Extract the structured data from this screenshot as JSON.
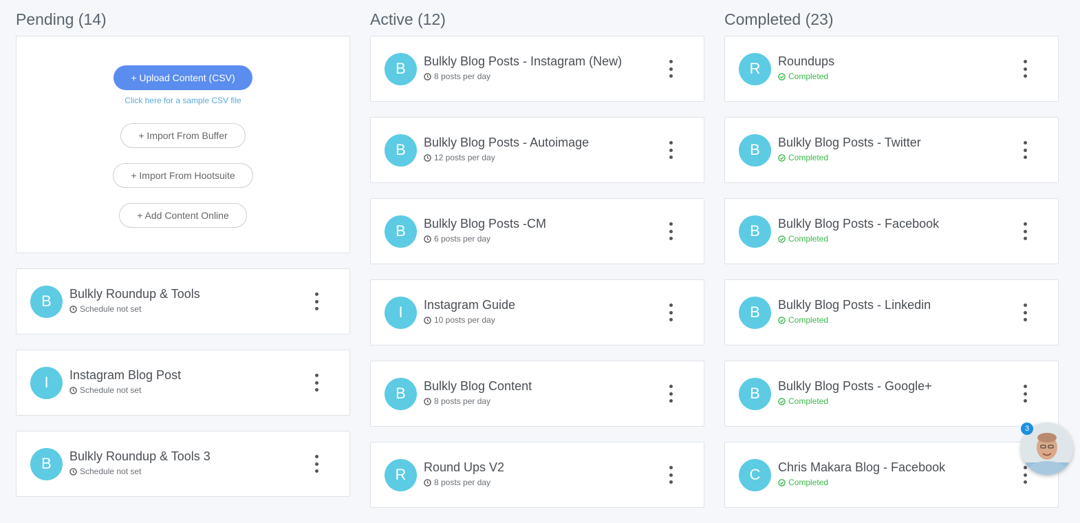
{
  "columns": {
    "pending": {
      "title": "Pending (14)",
      "upload": {
        "upload_button": "+ Upload Content (CSV)",
        "sample_link": "Click here for a sample CSV file",
        "buffer_button": "+ Import From Buffer",
        "hootsuite_button": "+ Import From Hootsuite",
        "online_button": "+ Add Content Online"
      },
      "items": [
        {
          "initial": "B",
          "title": "Bulkly Roundup & Tools",
          "subtitle": "Schedule not set"
        },
        {
          "initial": "I",
          "title": "Instagram Blog Post",
          "subtitle": "Schedule not set"
        },
        {
          "initial": "B",
          "title": "Bulkly Roundup & Tools 3",
          "subtitle": "Schedule not set"
        }
      ]
    },
    "active": {
      "title": "Active (12)",
      "items": [
        {
          "initial": "B",
          "title": "Bulkly Blog Posts - Instagram (New)",
          "subtitle": "8 posts per day"
        },
        {
          "initial": "B",
          "title": "Bulkly Blog Posts - Autoimage",
          "subtitle": "12 posts per day"
        },
        {
          "initial": "B",
          "title": "Bulkly Blog Posts -CM",
          "subtitle": "6 posts per day"
        },
        {
          "initial": "I",
          "title": "Instagram Guide",
          "subtitle": "10 posts per day"
        },
        {
          "initial": "B",
          "title": "Bulkly Blog Content",
          "subtitle": "8 posts per day"
        },
        {
          "initial": "R",
          "title": "Round Ups V2",
          "subtitle": "8 posts per day"
        }
      ]
    },
    "completed": {
      "title": "Completed (23)",
      "items": [
        {
          "initial": "R",
          "title": "Roundups",
          "subtitle": "Completed"
        },
        {
          "initial": "B",
          "title": "Bulkly Blog Posts - Twitter",
          "subtitle": "Completed"
        },
        {
          "initial": "B",
          "title": "Bulkly Blog Posts - Facebook",
          "subtitle": "Completed"
        },
        {
          "initial": "B",
          "title": "Bulkly Blog Posts - Linkedin",
          "subtitle": "Completed"
        },
        {
          "initial": "B",
          "title": "Bulkly Blog Posts - Google+",
          "subtitle": "Completed"
        },
        {
          "initial": "C",
          "title": "Chris Makara Blog - Facebook",
          "subtitle": "Completed"
        }
      ]
    }
  },
  "chat": {
    "badge_count": "3"
  },
  "colors": {
    "avatar": "#5ccbe3",
    "primary_button": "#5b8def",
    "completed_text": "#3bb84b",
    "link": "#5aa9d6",
    "badge": "#1d8fe0"
  }
}
